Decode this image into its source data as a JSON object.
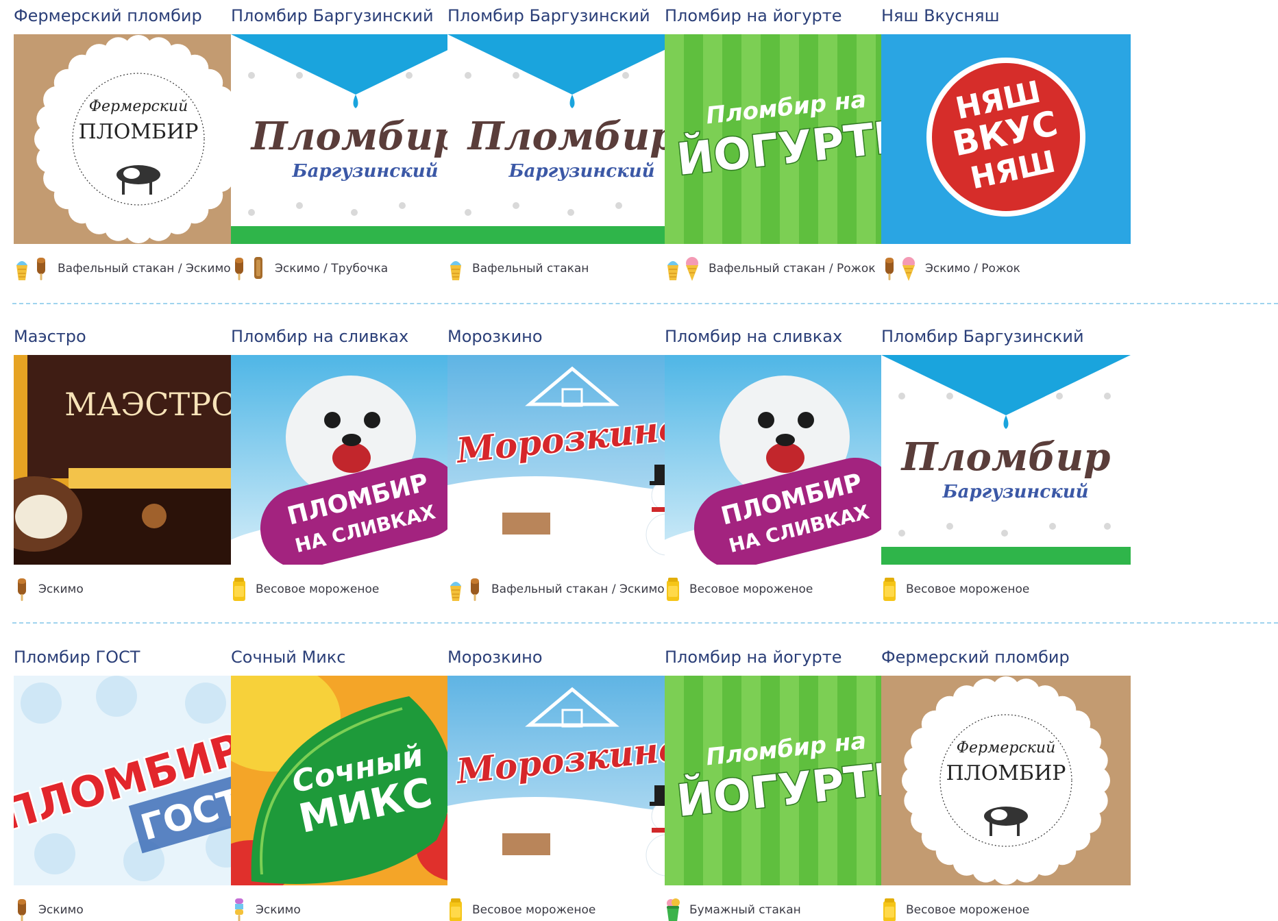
{
  "rows": [
    {
      "cards": [
        {
          "title": "Фермерский пломбир",
          "image": "farmer",
          "art_text": [
            "Фермерский",
            "ПЛОМБИР"
          ],
          "type_text": "Вафельный стакан / Эскимо",
          "icons": [
            "waffle-cup-icon",
            "eskimo-icon"
          ]
        },
        {
          "title": "Пломбир Баргузинский",
          "image": "barguzin",
          "art_text": [
            "Пломбир",
            "Баргузинский"
          ],
          "type_text": "Эскимо / Трубочка",
          "icons": [
            "eskimo-icon",
            "tube-icon"
          ]
        },
        {
          "title": "Пломбир Баргузинский",
          "image": "barguzin",
          "art_text": [
            "Пломбир",
            "Баргузинский"
          ],
          "type_text": "Вафельный стакан",
          "icons": [
            "waffle-cup-icon"
          ]
        },
        {
          "title": "Пломбир на йогурте",
          "image": "yogurt",
          "art_text": [
            "Пломбир на",
            "ЙОГУРТЕ"
          ],
          "type_text": "Вафельный стакан / Рожок",
          "icons": [
            "waffle-cup-icon",
            "cone-icon"
          ]
        },
        {
          "title": "Няш Вкусняш",
          "image": "nyash",
          "art_text": [
            "НЯШ",
            "ВКУС",
            "НЯШ"
          ],
          "type_text": "Эскимо  /  Рожок",
          "icons": [
            "eskimo-icon",
            "cone-icon"
          ]
        }
      ]
    },
    {
      "cards": [
        {
          "title": "Маэстро",
          "image": "maestro",
          "art_text": [
            "МАЭСТРО"
          ],
          "type_text": "Эскимо",
          "icons": [
            "eskimo-icon"
          ]
        },
        {
          "title": "Пломбир на сливках",
          "image": "slivki",
          "art_text": [
            "ПЛОМБИР",
            "НА СЛИВКАХ"
          ],
          "type_text": "Весовое мороженое",
          "icons": [
            "tub-icon"
          ]
        },
        {
          "title": "Морозкино",
          "image": "morozkino",
          "art_text": [
            "Морозкино"
          ],
          "type_text": "Вафельный стакан / Эскимо",
          "icons": [
            "waffle-cup-icon",
            "eskimo-icon"
          ]
        },
        {
          "title": "Пломбир на сливках",
          "image": "slivki",
          "art_text": [
            "ПЛОМБИР",
            "НА СЛИВКАХ"
          ],
          "type_text": "Весовое мороженое",
          "icons": [
            "tub-icon"
          ]
        },
        {
          "title": "Пломбир Баргузинский",
          "image": "barguzin",
          "art_text": [
            "Пломбир",
            "Баргузинский"
          ],
          "type_text": "Весовое мороженое",
          "icons": [
            "tub-icon"
          ]
        }
      ]
    },
    {
      "cards": [
        {
          "title": "Пломбир ГОСТ",
          "image": "gost",
          "art_text": [
            "ПЛОМБИР",
            "ГОСТ"
          ],
          "type_text": "Эскимо",
          "icons": [
            "eskimo-icon"
          ]
        },
        {
          "title": "Сочный Микс",
          "image": "sochny",
          "art_text": [
            "Сочный",
            "МИКС"
          ],
          "type_text": "Эскимо",
          "icons": [
            "fruit-ice-icon"
          ]
        },
        {
          "title": "Морозкино",
          "image": "morozkino",
          "art_text": [
            "Морозкино"
          ],
          "type_text": "Весовое мороженое",
          "icons": [
            "tub-icon"
          ]
        },
        {
          "title": "Пломбир на йогурте",
          "image": "yogurt",
          "art_text": [
            "Пломбир на",
            "ЙОГУРТЕ"
          ],
          "type_text": "Бумажный стакан",
          "icons": [
            "paper-cup-icon"
          ]
        },
        {
          "title": "Фермерский пломбир",
          "image": "farmer",
          "art_text": [
            "Фермерский",
            "ПЛОМБИР"
          ],
          "type_text": "Весовое мороженое",
          "icons": [
            "tub-icon"
          ]
        }
      ]
    }
  ],
  "colors": {
    "title": "#2b3f78",
    "divider": "#9fd3ee",
    "barguzin_blue": "#1aa4dd",
    "barguzin_green": "#2fb54a",
    "yogurt_green": "#5fbf3e",
    "nyash_red": "#d62d2a",
    "slivki_purple": "#a3237f",
    "morozkino_red": "#d6262a"
  }
}
